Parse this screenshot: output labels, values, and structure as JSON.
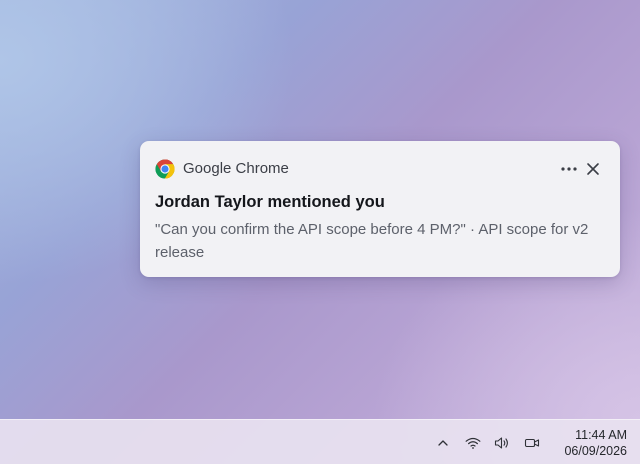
{
  "notification": {
    "app_name": "Google Chrome",
    "app_icon": "chrome-icon",
    "title": "Jordan Taylor mentioned you",
    "body": "\"Can you confirm the API scope before 4 PM?\" · API scope for v2 release",
    "actions": {
      "more_icon": "more-horizontal-icon",
      "close_icon": "close-icon"
    }
  },
  "taskbar": {
    "tray_icons": [
      "chevron-up-icon",
      "wifi-icon",
      "volume-icon",
      "camera-icon"
    ],
    "clock": {
      "time": "11:44 AM",
      "date": "06/09/2026"
    }
  },
  "colors": {
    "chrome_red": "#db4437",
    "chrome_yellow": "#f4c20d",
    "chrome_green": "#0f9d58",
    "chrome_blue": "#4285f4",
    "notification_bg": "#f2f2f5"
  }
}
